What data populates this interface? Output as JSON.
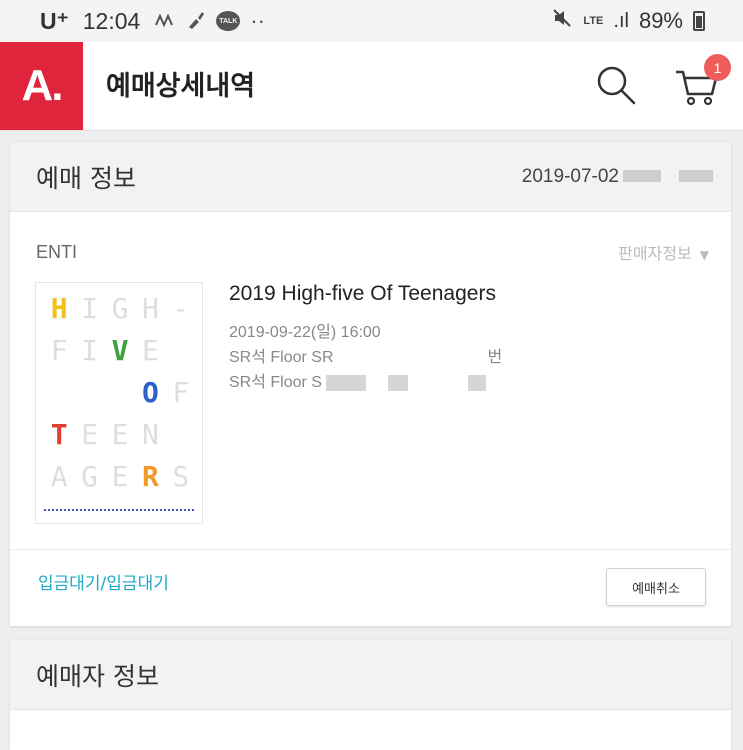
{
  "status_bar": {
    "carrier": "U⁺",
    "time": "12:04",
    "notif_dots": "··",
    "talk_label": "TALK",
    "network": "LTE",
    "signal": ".ıl",
    "battery": "89%"
  },
  "header": {
    "logo": "A.",
    "title": "예매상세내역",
    "cart_count": "1"
  },
  "booking_info": {
    "section_title": "예매 정보",
    "order_date": "2019-07-02",
    "seller": "ENTI",
    "seller_info_label": "판매자정보"
  },
  "event": {
    "title": "2019 High-five Of Teenagers",
    "datetime": "2019-09-22(일) 16:00",
    "seat_1": "SR석 Floor SR",
    "seat_1_suffix": "번",
    "seat_2": "SR석 Floor S"
  },
  "poster": {
    "rows": [
      [
        "H",
        "I",
        "G",
        "H",
        "-"
      ],
      [
        "F",
        "I",
        "V",
        "E",
        ""
      ],
      [
        "",
        "",
        "",
        "O",
        "F"
      ],
      [
        "T",
        "E",
        "E",
        "N",
        ""
      ],
      [
        "A",
        "G",
        "E",
        "R",
        "S"
      ]
    ],
    "accent_colors": {
      "yellow": "#f2c21a",
      "green": "#3aa53a",
      "blue": "#2a62c9",
      "red": "#e0402f",
      "orange": "#f09a2a",
      "faint": "#dedede"
    }
  },
  "actions": {
    "payment_status": "입금대기/입금대기",
    "cancel_label": "예매취소"
  },
  "booker_info": {
    "section_title": "예매자 정보"
  },
  "colors": {
    "brand": "#e0243b",
    "link": "#1fa8c9",
    "badge": "#f05b5b"
  }
}
